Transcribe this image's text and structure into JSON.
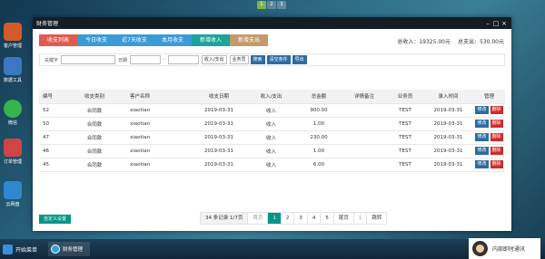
{
  "desktop": {
    "pager": [
      "1",
      "2",
      "3"
    ],
    "icons": [
      {
        "label": "客户管理",
        "color": "#d35b2a"
      },
      {
        "label": "数据工具",
        "color": "#3c77c4"
      },
      {
        "label": "微信",
        "color": "#35b54a"
      },
      {
        "label": "订单管理",
        "color": "#cf4545"
      },
      {
        "label": "云网盘",
        "color": "#2f87d0"
      }
    ]
  },
  "window": {
    "title": "财务管理",
    "controls": {
      "minimize": "–",
      "maximize": "□",
      "close": "×"
    }
  },
  "tabs": [
    {
      "label": "收支列表",
      "color": "#e05a4f"
    },
    {
      "label": "今日收支",
      "color": "#3a9bd6"
    },
    {
      "label": "近7天收支",
      "color": "#3a9bd6"
    },
    {
      "label": "本月收支",
      "color": "#3a9bd6"
    },
    {
      "label": "新增收入",
      "color": "#1aa49a"
    },
    {
      "label": "新增支出",
      "color": "#c49a6c"
    }
  ],
  "totals": {
    "income": "总收入：19325.00元",
    "expense": "总支出：530.00元"
  },
  "filters": {
    "keyword_label": "关键字",
    "date_label": "日期",
    "date_separator": "-",
    "type_select": "收入/支出",
    "salesman_select": "业务员",
    "search_btn": "搜索",
    "clear_btn": "清空条件",
    "export_btn": "导出"
  },
  "table": {
    "headers": [
      "编号",
      "收支类别",
      "客户名称",
      "收支日期",
      "收入/支出",
      "总金额",
      "详情备注",
      "业务员",
      "录入时间",
      "管理"
    ],
    "rows": [
      {
        "id": "52",
        "category": "合同款",
        "customer": "xiaotian",
        "date": "2019-03-31",
        "type": "收入",
        "amount": "900.00",
        "note": "",
        "salesman": "TEST",
        "entry": "2019-03-31"
      },
      {
        "id": "50",
        "category": "合同款",
        "customer": "xiaotian",
        "date": "2019-03-31",
        "type": "收入",
        "amount": "1.00",
        "note": "",
        "salesman": "TEST",
        "entry": "2019-03-31"
      },
      {
        "id": "47",
        "category": "合同款",
        "customer": "xiaotian",
        "date": "2019-03-31",
        "type": "收入",
        "amount": "230.00",
        "note": "",
        "salesman": "TEST",
        "entry": "2019-03-31"
      },
      {
        "id": "46",
        "category": "合同款",
        "customer": "xiaotian",
        "date": "2019-03-31",
        "type": "收入",
        "amount": "1.00",
        "note": "",
        "salesman": "TEST",
        "entry": "2019-03-31"
      },
      {
        "id": "45",
        "category": "合同款",
        "customer": "xiaotian",
        "date": "2019-03-31",
        "type": "收入",
        "amount": "6.00",
        "note": "",
        "salesman": "TEST",
        "entry": "2019-03-31"
      }
    ],
    "edit_label": "修改",
    "delete_label": "删除"
  },
  "footer": {
    "custom_btn": "自定义设置",
    "pager": {
      "count": "34 条记录 1/7页",
      "first": "首页",
      "pages": [
        "1",
        "2",
        "3",
        "4",
        "5"
      ],
      "current": "1",
      "last": "尾页",
      "input": "1",
      "jump": "跳转"
    }
  },
  "taskbar": {
    "start": "开始菜单",
    "app": "财务管理",
    "im": "内部即时通讯"
  }
}
